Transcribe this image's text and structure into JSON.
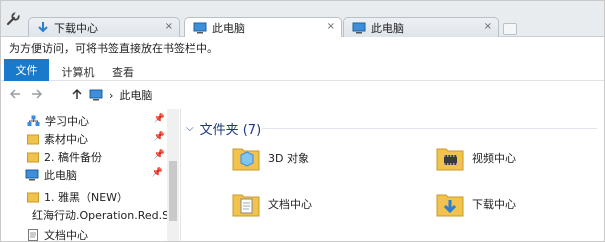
{
  "browser": {
    "tabs": [
      {
        "label": "下载中心",
        "icon": "download-arrow-icon",
        "active": false
      },
      {
        "label": "此电脑",
        "icon": "computer-icon",
        "active": true
      },
      {
        "label": "此电脑",
        "icon": "computer-icon",
        "active": false
      }
    ],
    "close_glyph": "×",
    "bookmark_notice": "为方便访问，可将书签直接放在书签栏中。"
  },
  "ribbon": {
    "tabs": [
      "文件",
      "计算机",
      "查看"
    ]
  },
  "address": {
    "back_icon": "back-arrow-icon",
    "forward_icon": "forward-arrow-icon",
    "up_icon": "up-arrow-icon",
    "path_separator": "›",
    "path": "此电脑"
  },
  "nav_pane": {
    "items": [
      {
        "label": "学习中心",
        "icon": "network-icon",
        "pinned": true
      },
      {
        "label": "素材中心",
        "icon": "folder-icon",
        "pinned": true
      },
      {
        "label": "2. 稿件备份",
        "icon": "folder-icon",
        "pinned": true
      },
      {
        "label": "此电脑",
        "icon": "computer-icon",
        "pinned": true
      },
      {
        "label": "1. 雅黑（NEW）",
        "icon": "folder-icon",
        "pinned": false
      },
      {
        "label": "红海行动.Operation.Red.Sea.",
        "icon": "folder-icon",
        "pinned": false
      },
      {
        "label": "文档中心",
        "icon": "document-icon",
        "pinned": false
      }
    ]
  },
  "content": {
    "section_title": "文件夹 (7)",
    "folders": [
      {
        "label": "3D 对象",
        "icon": "3d-objects-folder-icon"
      },
      {
        "label": "视频中心",
        "icon": "video-folder-icon"
      },
      {
        "label": "文档中心",
        "icon": "documents-folder-icon"
      },
      {
        "label": "下载中心",
        "icon": "downloads-folder-icon"
      }
    ]
  },
  "colors": {
    "accent": "#1979ca",
    "folder": "#f1c24d",
    "section_text": "#1e3a78"
  }
}
